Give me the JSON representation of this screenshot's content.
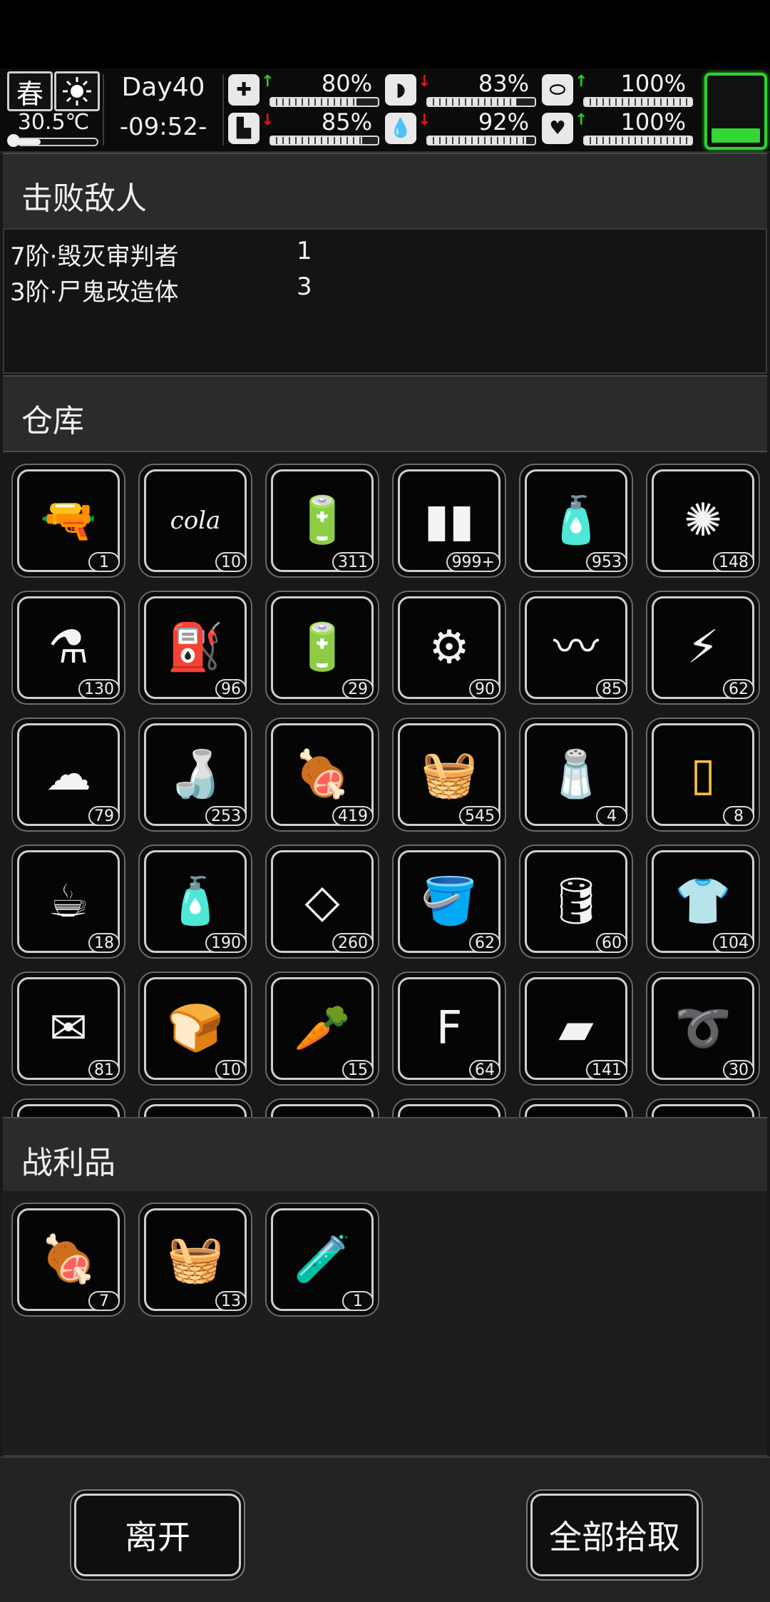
{
  "hud": {
    "season": "春",
    "weather_icon": "sun-icon",
    "temperature": "30.5℃",
    "temperature_level": 0.3,
    "day": "Day40",
    "time": "-09:52-",
    "stats": [
      {
        "name": "health",
        "icon": "medkit-icon",
        "glyph": "✚",
        "trend": "up",
        "value": "80%",
        "level": 0.8
      },
      {
        "name": "hunger",
        "icon": "stomach-icon",
        "glyph": "◗",
        "trend": "down",
        "value": "83%",
        "level": 0.83
      },
      {
        "name": "mood",
        "icon": "pill-icon",
        "glyph": "⬭",
        "trend": "up",
        "value": "100%",
        "level": 1.0
      },
      {
        "name": "stamina",
        "icon": "boot-icon",
        "glyph": "▙",
        "trend": "down",
        "value": "85%",
        "level": 0.85
      },
      {
        "name": "thirst",
        "icon": "water-drop-icon",
        "glyph": "💧",
        "trend": "down",
        "value": "92%",
        "level": 0.92
      },
      {
        "name": "spirit",
        "icon": "heart-icon",
        "glyph": "♥",
        "trend": "up",
        "value": "100%",
        "level": 1.0
      }
    ],
    "battery_color": "#2fd12f"
  },
  "defeated": {
    "title": "击败敌人",
    "enemies": [
      {
        "name": "7阶·毁灭审判者",
        "count": "1"
      },
      {
        "name": "3阶·尸鬼改造体",
        "count": "3"
      }
    ]
  },
  "warehouse": {
    "title": "仓库",
    "items": [
      {
        "icon": "flare-gun-icon",
        "glyph": "🔫",
        "count": "1"
      },
      {
        "icon": "cola-cup-icon",
        "glyph": "cola",
        "count": "10"
      },
      {
        "icon": "battery-pack-icon",
        "glyph": "🔋",
        "count": "311"
      },
      {
        "icon": "bullets-icon",
        "glyph": "▮▮",
        "count": "999+"
      },
      {
        "icon": "plastic-bottle-icon",
        "glyph": "🧴",
        "count": "953"
      },
      {
        "icon": "fiber-icon",
        "glyph": "✺",
        "count": "148"
      },
      {
        "icon": "flask-icon",
        "glyph": "⚗",
        "count": "130"
      },
      {
        "icon": "jerrycan-icon",
        "glyph": "⛽",
        "count": "96"
      },
      {
        "icon": "aa-battery-icon",
        "glyph": "🔋",
        "count": "29"
      },
      {
        "icon": "gears-icon",
        "glyph": "⚙",
        "count": "90"
      },
      {
        "icon": "wires-icon",
        "glyph": "〰",
        "count": "85"
      },
      {
        "icon": "circuit-parts-icon",
        "glyph": "⚡",
        "count": "62"
      },
      {
        "icon": "cotton-icon",
        "glyph": "☁",
        "count": "79"
      },
      {
        "icon": "glass-bottle-icon",
        "glyph": "🍶",
        "count": "253"
      },
      {
        "icon": "meat-icon",
        "glyph": "🍖",
        "count": "419"
      },
      {
        "icon": "cloth-icon",
        "glyph": "🧺",
        "count": "545"
      },
      {
        "icon": "spice-bottle-icon",
        "glyph": "🧂",
        "count": "4"
      },
      {
        "icon": "juice-glass-icon",
        "glyph": "▯",
        "count": "8",
        "accent": "#f5c542"
      },
      {
        "icon": "coffee-cup-icon",
        "glyph": "☕",
        "count": "18"
      },
      {
        "icon": "spray-bottle-icon",
        "glyph": "🧴",
        "count": "190"
      },
      {
        "icon": "glass-shards-icon",
        "glyph": "◇",
        "count": "260"
      },
      {
        "icon": "bucket-icon",
        "glyph": "🪣",
        "count": "62"
      },
      {
        "icon": "fuel-barrel-icon",
        "glyph": "🛢",
        "count": "60"
      },
      {
        "icon": "tattered-shirt-icon",
        "glyph": "👕",
        "count": "104"
      },
      {
        "icon": "crumpled-paper-icon",
        "glyph": "✉",
        "count": "81"
      },
      {
        "icon": "bread-icon",
        "glyph": "🍞",
        "count": "10"
      },
      {
        "icon": "carrot-icon",
        "glyph": "🥕",
        "count": "15"
      },
      {
        "icon": "flour-bag-icon",
        "glyph": "F",
        "count": "64"
      },
      {
        "icon": "fabric-icon",
        "glyph": "▰",
        "count": "141"
      },
      {
        "icon": "rope-icon",
        "glyph": "➰",
        "count": "30"
      }
    ]
  },
  "loot": {
    "title": "战利品",
    "items": [
      {
        "icon": "meat-icon",
        "glyph": "🍖",
        "count": "7"
      },
      {
        "icon": "cloth-icon",
        "glyph": "🧺",
        "count": "13"
      },
      {
        "icon": "test-tube-vii-icon",
        "glyph": "🧪",
        "count": "1"
      }
    ]
  },
  "footer": {
    "leave_label": "离开",
    "take_all_label": "全部拾取"
  }
}
